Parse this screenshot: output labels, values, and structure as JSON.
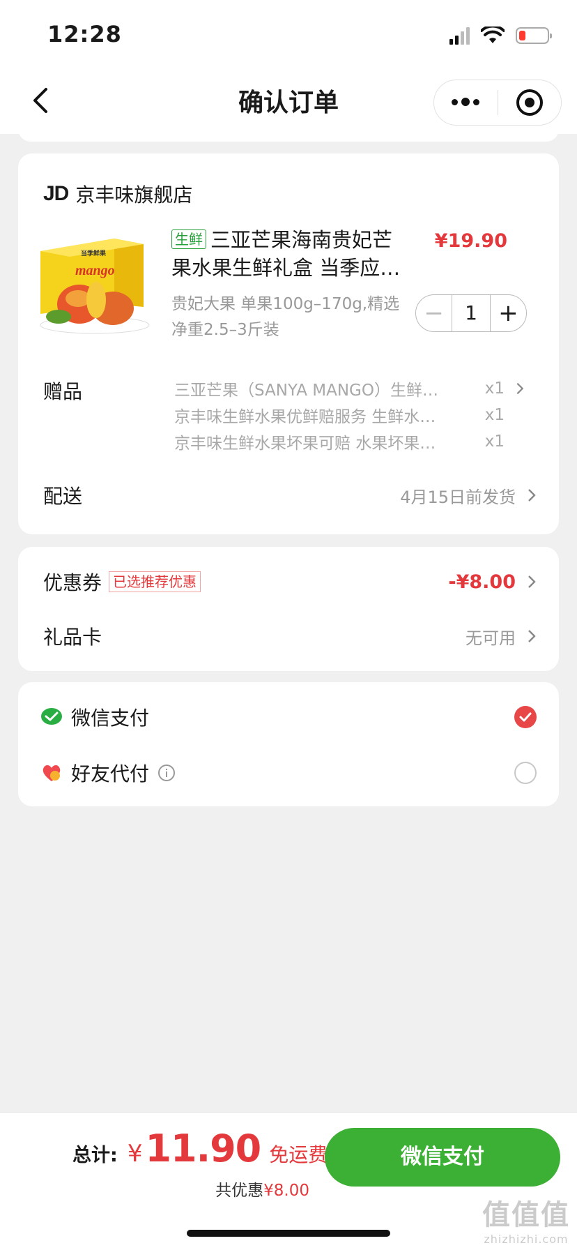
{
  "status_bar": {
    "time": "12:28"
  },
  "nav": {
    "title": "确认订单"
  },
  "store": {
    "logo": "JD",
    "name": "京丰味旗舰店",
    "product": {
      "tag": "生鲜",
      "title": "三亚芒果海南贵妃芒果水果生鲜礼盒 当季应…",
      "price": "¥19.90",
      "spec": "贵妃大果 单果100g–170g,精选净重2.5–3斤装",
      "quantity": "1",
      "image_box_text": "当季鲜果",
      "image_brand_text": "mango"
    },
    "gifts": {
      "label": "赠品",
      "items": [
        {
          "name": "三亚芒果（SANYA MANGO）生鲜…",
          "qty": "x1"
        },
        {
          "name": "京丰味生鲜水果优鲜赔服务 生鲜水…",
          "qty": "x1"
        },
        {
          "name": "京丰味生鲜水果坏果可赔 水果坏果…",
          "qty": "x1"
        }
      ]
    },
    "delivery": {
      "label": "配送",
      "value": "4月15日前发货"
    }
  },
  "discounts": {
    "coupon": {
      "label": "优惠券",
      "badge": "已选推荐优惠",
      "value": "-¥8.00"
    },
    "gift_card": {
      "label": "礼品卡",
      "value": "无可用"
    }
  },
  "payment": {
    "wechat": {
      "label": "微信支付",
      "selected": true
    },
    "friend": {
      "label": "好友代付",
      "selected": false
    }
  },
  "bottom": {
    "total_label": "总计:",
    "currency": "¥",
    "total": "11.90",
    "shipping": "免运费",
    "saving_label": "共优惠",
    "saving_value": "¥8.00",
    "pay_button": "微信支付"
  },
  "watermark": {
    "main": "值值值",
    "url": "zhizhizhi.com"
  },
  "colors": {
    "price_red": "#e4393c",
    "pay_green": "#3cb034",
    "tag_green": "#27a03b"
  }
}
